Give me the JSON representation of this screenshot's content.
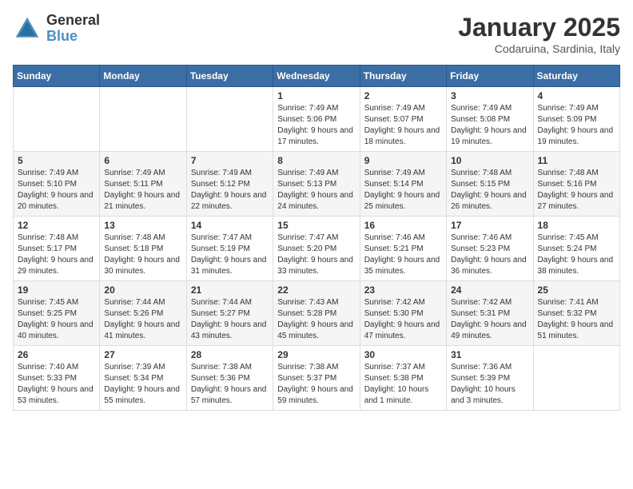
{
  "app": {
    "logo_general": "General",
    "logo_blue": "Blue"
  },
  "header": {
    "month_title": "January 2025",
    "location": "Codaruina, Sardinia, Italy"
  },
  "days_of_week": [
    "Sunday",
    "Monday",
    "Tuesday",
    "Wednesday",
    "Thursday",
    "Friday",
    "Saturday"
  ],
  "weeks": [
    [
      {
        "day": "",
        "info": ""
      },
      {
        "day": "",
        "info": ""
      },
      {
        "day": "",
        "info": ""
      },
      {
        "day": "1",
        "info": "Sunrise: 7:49 AM\nSunset: 5:06 PM\nDaylight: 9 hours and 17 minutes."
      },
      {
        "day": "2",
        "info": "Sunrise: 7:49 AM\nSunset: 5:07 PM\nDaylight: 9 hours and 18 minutes."
      },
      {
        "day": "3",
        "info": "Sunrise: 7:49 AM\nSunset: 5:08 PM\nDaylight: 9 hours and 19 minutes."
      },
      {
        "day": "4",
        "info": "Sunrise: 7:49 AM\nSunset: 5:09 PM\nDaylight: 9 hours and 19 minutes."
      }
    ],
    [
      {
        "day": "5",
        "info": "Sunrise: 7:49 AM\nSunset: 5:10 PM\nDaylight: 9 hours and 20 minutes."
      },
      {
        "day": "6",
        "info": "Sunrise: 7:49 AM\nSunset: 5:11 PM\nDaylight: 9 hours and 21 minutes."
      },
      {
        "day": "7",
        "info": "Sunrise: 7:49 AM\nSunset: 5:12 PM\nDaylight: 9 hours and 22 minutes."
      },
      {
        "day": "8",
        "info": "Sunrise: 7:49 AM\nSunset: 5:13 PM\nDaylight: 9 hours and 24 minutes."
      },
      {
        "day": "9",
        "info": "Sunrise: 7:49 AM\nSunset: 5:14 PM\nDaylight: 9 hours and 25 minutes."
      },
      {
        "day": "10",
        "info": "Sunrise: 7:48 AM\nSunset: 5:15 PM\nDaylight: 9 hours and 26 minutes."
      },
      {
        "day": "11",
        "info": "Sunrise: 7:48 AM\nSunset: 5:16 PM\nDaylight: 9 hours and 27 minutes."
      }
    ],
    [
      {
        "day": "12",
        "info": "Sunrise: 7:48 AM\nSunset: 5:17 PM\nDaylight: 9 hours and 29 minutes."
      },
      {
        "day": "13",
        "info": "Sunrise: 7:48 AM\nSunset: 5:18 PM\nDaylight: 9 hours and 30 minutes."
      },
      {
        "day": "14",
        "info": "Sunrise: 7:47 AM\nSunset: 5:19 PM\nDaylight: 9 hours and 31 minutes."
      },
      {
        "day": "15",
        "info": "Sunrise: 7:47 AM\nSunset: 5:20 PM\nDaylight: 9 hours and 33 minutes."
      },
      {
        "day": "16",
        "info": "Sunrise: 7:46 AM\nSunset: 5:21 PM\nDaylight: 9 hours and 35 minutes."
      },
      {
        "day": "17",
        "info": "Sunrise: 7:46 AM\nSunset: 5:23 PM\nDaylight: 9 hours and 36 minutes."
      },
      {
        "day": "18",
        "info": "Sunrise: 7:45 AM\nSunset: 5:24 PM\nDaylight: 9 hours and 38 minutes."
      }
    ],
    [
      {
        "day": "19",
        "info": "Sunrise: 7:45 AM\nSunset: 5:25 PM\nDaylight: 9 hours and 40 minutes."
      },
      {
        "day": "20",
        "info": "Sunrise: 7:44 AM\nSunset: 5:26 PM\nDaylight: 9 hours and 41 minutes."
      },
      {
        "day": "21",
        "info": "Sunrise: 7:44 AM\nSunset: 5:27 PM\nDaylight: 9 hours and 43 minutes."
      },
      {
        "day": "22",
        "info": "Sunrise: 7:43 AM\nSunset: 5:28 PM\nDaylight: 9 hours and 45 minutes."
      },
      {
        "day": "23",
        "info": "Sunrise: 7:42 AM\nSunset: 5:30 PM\nDaylight: 9 hours and 47 minutes."
      },
      {
        "day": "24",
        "info": "Sunrise: 7:42 AM\nSunset: 5:31 PM\nDaylight: 9 hours and 49 minutes."
      },
      {
        "day": "25",
        "info": "Sunrise: 7:41 AM\nSunset: 5:32 PM\nDaylight: 9 hours and 51 minutes."
      }
    ],
    [
      {
        "day": "26",
        "info": "Sunrise: 7:40 AM\nSunset: 5:33 PM\nDaylight: 9 hours and 53 minutes."
      },
      {
        "day": "27",
        "info": "Sunrise: 7:39 AM\nSunset: 5:34 PM\nDaylight: 9 hours and 55 minutes."
      },
      {
        "day": "28",
        "info": "Sunrise: 7:38 AM\nSunset: 5:36 PM\nDaylight: 9 hours and 57 minutes."
      },
      {
        "day": "29",
        "info": "Sunrise: 7:38 AM\nSunset: 5:37 PM\nDaylight: 9 hours and 59 minutes."
      },
      {
        "day": "30",
        "info": "Sunrise: 7:37 AM\nSunset: 5:38 PM\nDaylight: 10 hours and 1 minute."
      },
      {
        "day": "31",
        "info": "Sunrise: 7:36 AM\nSunset: 5:39 PM\nDaylight: 10 hours and 3 minutes."
      },
      {
        "day": "",
        "info": ""
      }
    ]
  ]
}
